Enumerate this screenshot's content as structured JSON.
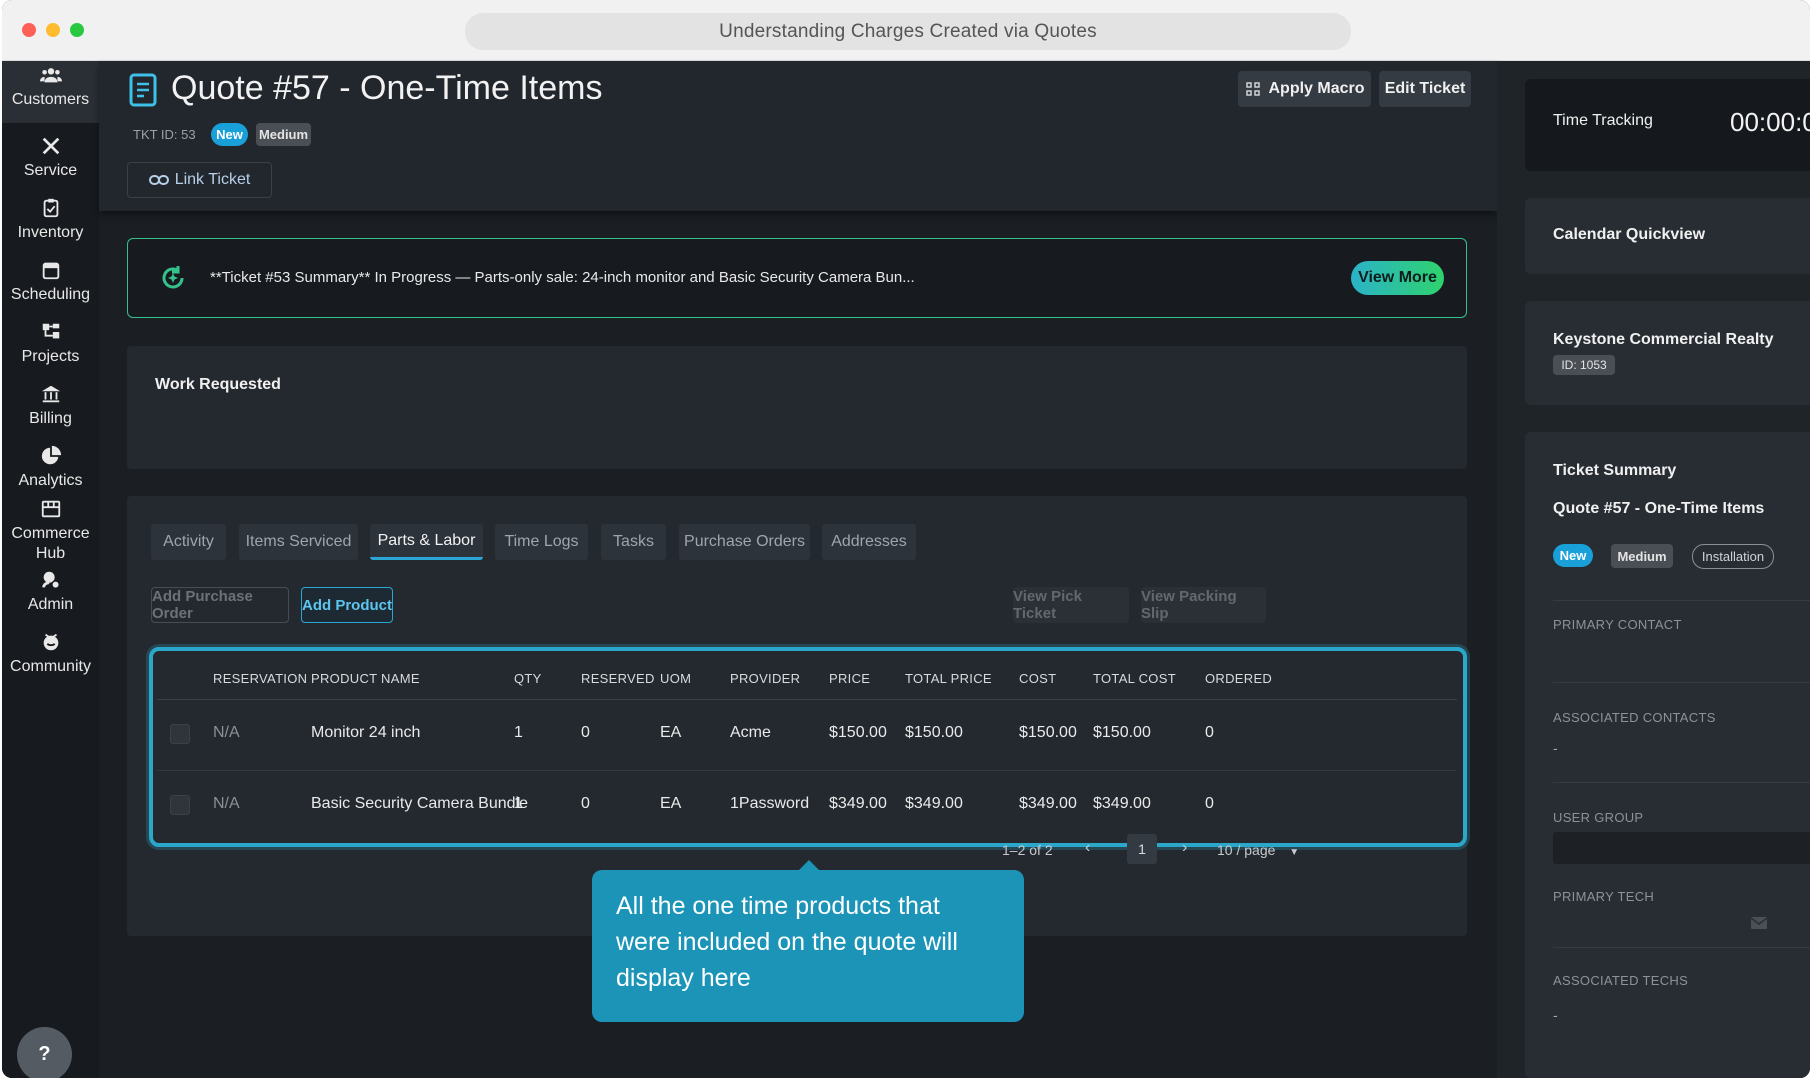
{
  "browser": {
    "title": "Understanding Charges Created via Quotes"
  },
  "sidebar": {
    "items": [
      {
        "label": "Customers",
        "icon": "customers-icon"
      },
      {
        "label": "Service",
        "icon": "service-icon"
      },
      {
        "label": "Inventory",
        "icon": "inventory-icon"
      },
      {
        "label": "Scheduling",
        "icon": "calendar-icon"
      },
      {
        "label": "Projects",
        "icon": "projects-icon"
      },
      {
        "label": "Billing",
        "icon": "billing-icon"
      },
      {
        "label": "Analytics",
        "icon": "pie-chart-icon"
      },
      {
        "label": "Commerce Hub",
        "icon": "store-icon"
      },
      {
        "label": "Admin",
        "icon": "admin-icon"
      },
      {
        "label": "Community",
        "icon": "community-icon"
      }
    ],
    "help_label": "?"
  },
  "header": {
    "title": "Quote #57 - One-Time Items",
    "ticket_id": "TKT ID: 53",
    "status_badge": "New",
    "priority_badge": "Medium",
    "link_ticket_label": "Link Ticket",
    "apply_macro_label": "Apply Macro",
    "edit_ticket_label": "Edit Ticket"
  },
  "summary": {
    "text": "**Ticket #53 Summary** In Progress — Parts-only sale: 24-inch monitor and Basic Security Camera Bun...",
    "view_more_label": "View More"
  },
  "work_requested": {
    "title": "Work Requested"
  },
  "tabs": [
    "Activity",
    "Items Serviced",
    "Parts & Labor",
    "Time Logs",
    "Tasks",
    "Purchase Orders",
    "Addresses"
  ],
  "active_tab": "Parts & Labor",
  "actions": {
    "add_purchase_order": "Add Purchase Order",
    "add_product": "Add Product",
    "view_pick_ticket": "View Pick Ticket",
    "view_packing_slip": "View Packing Slip"
  },
  "table": {
    "columns": [
      "RESERVATION",
      "PRODUCT NAME",
      "QTY",
      "RESERVED",
      "UOM",
      "PROVIDER",
      "PRICE",
      "TOTAL PRICE",
      "COST",
      "TOTAL COST",
      "ORDERED"
    ],
    "rows": [
      [
        "N/A",
        "Monitor 24 inch",
        "1",
        "0",
        "EA",
        "Acme",
        "$150.00",
        "$150.00",
        "$150.00",
        "$150.00",
        "0"
      ],
      [
        "N/A",
        "Basic Security Camera Bundle",
        "1",
        "0",
        "EA",
        "1Password",
        "$349.00",
        "$349.00",
        "$349.00",
        "$349.00",
        "0"
      ]
    ]
  },
  "pagination": {
    "range": "1–2 of 2",
    "current_page": "1",
    "page_size": "10 / page"
  },
  "callout": {
    "text": "All the one time products that were included on the quote will display here"
  },
  "right_panel": {
    "time_tracking_label": "Time Tracking",
    "timer": "00:00:0",
    "calendar_label": "Calendar Quickview",
    "company_name": "Keystone Commercial Realty",
    "company_id": "ID: 1053",
    "ticket_summary_label": "Ticket Summary",
    "ticket_summary_title": "Quote #57 - One-Time Items",
    "status_badge": "New",
    "priority_badge": "Medium",
    "type_badge": "Installation",
    "primary_contact_label": "PRIMARY CONTACT",
    "associated_contacts_label": "ASSOCIATED CONTACTS",
    "associated_contacts_value": "-",
    "user_group_label": "USER GROUP",
    "primary_tech_label": "PRIMARY TECH",
    "associated_techs_label": "ASSOCIATED TECHS",
    "associated_techs_value": "-"
  },
  "colors": {
    "accent": "#2aa7c9",
    "new_badge": "#1aa0d9",
    "summary_border": "#33c28a",
    "callout": "#1b94b8"
  }
}
